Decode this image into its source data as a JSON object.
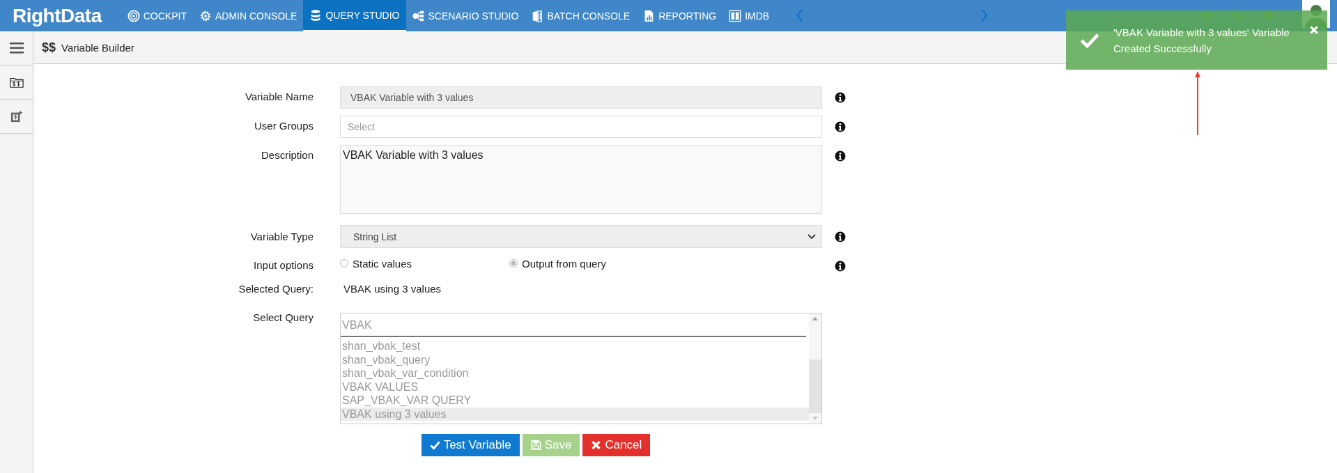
{
  "topbar": {
    "logo": "RightData",
    "nav": [
      {
        "label": "COCKPIT",
        "kind": "target",
        "selected": false
      },
      {
        "label": "ADMIN CONSOLE",
        "kind": "gear",
        "selected": false
      },
      {
        "label": "QUERY STUDIO",
        "kind": "database",
        "selected": true
      },
      {
        "label": "SCENARIO STUDIO",
        "kind": "flow",
        "selected": false
      },
      {
        "label": "BATCH CONSOLE",
        "kind": "book",
        "selected": false
      },
      {
        "label": "REPORTING",
        "kind": "report",
        "selected": false
      },
      {
        "label": "IMDB",
        "kind": "columns",
        "selected": false
      }
    ]
  },
  "page_header": {
    "icon_text": "$$",
    "title": "Variable Builder"
  },
  "form": {
    "variable_name": {
      "label": "Variable Name",
      "value": "VBAK Variable with 3 values"
    },
    "user_groups": {
      "label": "User Groups",
      "placeholder": "Select"
    },
    "description": {
      "label": "Description",
      "value": "VBAK Variable with 3 values"
    },
    "variable_type": {
      "label": "Variable Type",
      "value": "String List"
    },
    "input_options": {
      "label": "Input options",
      "options": [
        {
          "label": "Static values",
          "selected": false
        },
        {
          "label": "Output from query",
          "selected": true
        }
      ]
    },
    "selected_query": {
      "label": "Selected Query:",
      "value": "VBAK using 3 values"
    },
    "select_query": {
      "label": "Select Query",
      "search": "VBAK",
      "items": [
        {
          "label": "shan_vbak_test",
          "selected": false
        },
        {
          "label": "shan_vbak_query",
          "selected": false
        },
        {
          "label": "shan_vbak_var_condition",
          "selected": false
        },
        {
          "label": "VBAK VALUES",
          "selected": false
        },
        {
          "label": "SAP_VBAK_VAR QUERY",
          "selected": false
        },
        {
          "label": "VBAK using 3 values",
          "selected": true
        }
      ]
    }
  },
  "buttons": [
    {
      "label": "Test Variable",
      "kind": "primary",
      "disabled": false
    },
    {
      "label": "Save",
      "kind": "success",
      "disabled": true
    },
    {
      "label": "Cancel",
      "kind": "danger",
      "disabled": false
    }
  ],
  "toast": {
    "message": "'VBAK Variable with 3 values' Variable Created Successfully"
  }
}
